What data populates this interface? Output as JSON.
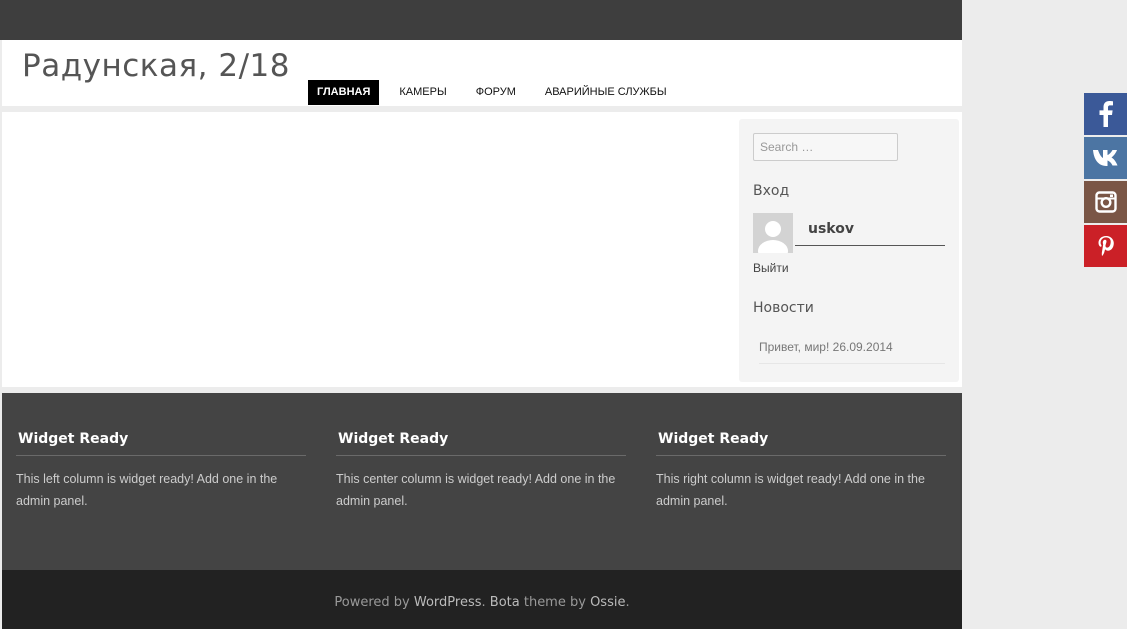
{
  "site": {
    "title": "Радунская, 2/18"
  },
  "nav": {
    "items": [
      {
        "label": "ГЛАВНАЯ"
      },
      {
        "label": "КАМЕРЫ"
      },
      {
        "label": "ФОРУМ"
      },
      {
        "label": "АВАРИЙНЫЕ СЛУЖБЫ"
      }
    ]
  },
  "sidebar": {
    "search_placeholder": "Search …",
    "login_title": "Вход",
    "username": "uskov",
    "logout": "Выйти",
    "news_title": "Новости",
    "news": [
      {
        "title": "Привет, мир!",
        "date": "26.09.2014"
      }
    ]
  },
  "footer_widgets": [
    {
      "title": "Widget Ready",
      "text": "This left column is widget ready! Add one in the admin panel."
    },
    {
      "title": "Widget Ready",
      "text": "This center column is widget ready! Add one in the admin panel."
    },
    {
      "title": "Widget Ready",
      "text": "This right column is widget ready! Add one in the admin panel."
    }
  ],
  "footer": {
    "powered_by": "Powered by ",
    "wordpress": "WordPress",
    "sep": ". ",
    "theme_name": "Bota",
    "theme_by": " theme by ",
    "author": "Ossie",
    "end": "."
  },
  "social": [
    {
      "name": "facebook",
      "color": "#3b5998"
    },
    {
      "name": "vk",
      "color": "#4c75a3"
    },
    {
      "name": "instagram",
      "color": "#7a5646"
    },
    {
      "name": "pinterest",
      "color": "#cb2027"
    }
  ]
}
